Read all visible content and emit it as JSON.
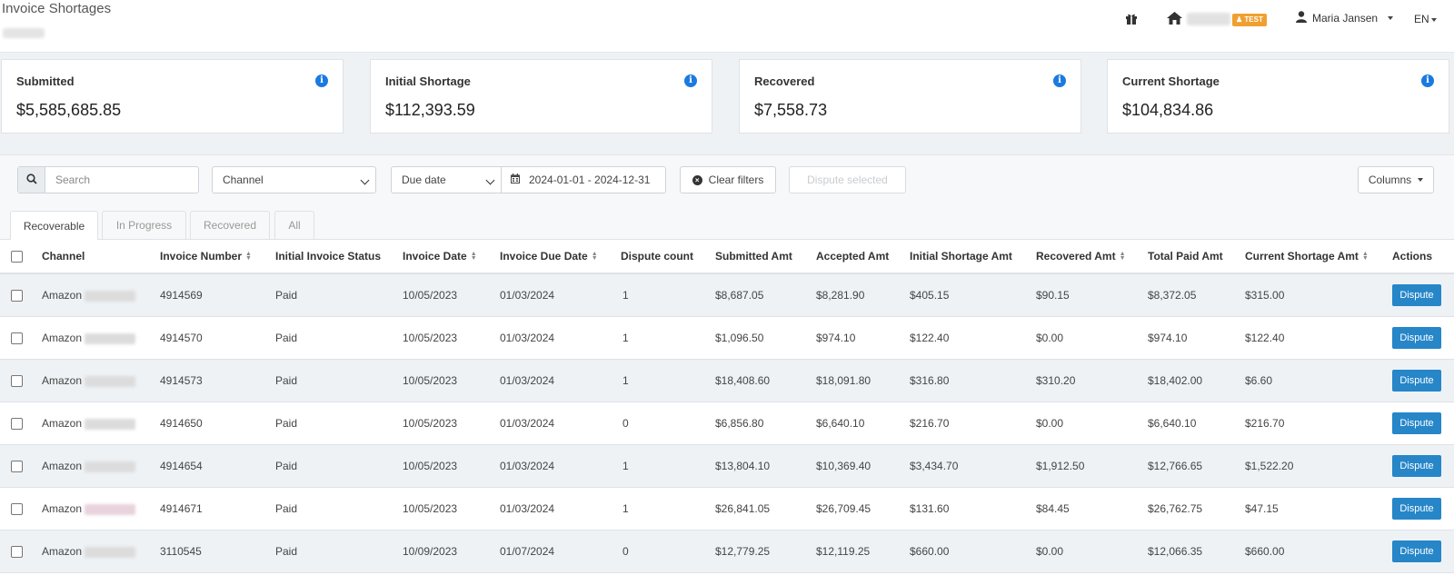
{
  "header": {
    "title": "Invoice Shortages",
    "test_badge": "TEST",
    "user_name": "Maria Jansen",
    "language": "EN"
  },
  "summary_cards": [
    {
      "label": "Submitted",
      "value": "$5,585,685.85"
    },
    {
      "label": "Initial Shortage",
      "value": "$112,393.59"
    },
    {
      "label": "Recovered",
      "value": "$7,558.73"
    },
    {
      "label": "Current Shortage",
      "value": "$104,834.86"
    }
  ],
  "toolbar": {
    "search_placeholder": "Search",
    "channel_select": "Channel",
    "date_field_select": "Due date",
    "date_range": "2024-01-01 - 2024-12-31",
    "clear_filters": "Clear filters",
    "dispute_selected": "Dispute selected",
    "columns": "Columns"
  },
  "tabs": [
    "Recoverable",
    "In Progress",
    "Recovered",
    "All"
  ],
  "table": {
    "headers": [
      "Channel",
      "Invoice Number",
      "Initial Invoice Status",
      "Invoice Date",
      "Invoice Due Date",
      "Dispute count",
      "Submitted Amt",
      "Accepted Amt",
      "Initial Shortage Amt",
      "Recovered Amt",
      "Total Paid Amt",
      "Current Shortage Amt",
      "Actions"
    ],
    "action_label": "Dispute",
    "rows": [
      {
        "channel": "Amazon",
        "invoice": "4914569",
        "status": "Paid",
        "inv_date": "10/05/2023",
        "due_date": "01/03/2024",
        "disputes": "1",
        "submitted": "$8,687.05",
        "accepted": "$8,281.90",
        "initial": "$405.15",
        "recovered": "$90.15",
        "paid": "$8,372.05",
        "current": "$315.00"
      },
      {
        "channel": "Amazon",
        "invoice": "4914570",
        "status": "Paid",
        "inv_date": "10/05/2023",
        "due_date": "01/03/2024",
        "disputes": "1",
        "submitted": "$1,096.50",
        "accepted": "$974.10",
        "initial": "$122.40",
        "recovered": "$0.00",
        "paid": "$974.10",
        "current": "$122.40"
      },
      {
        "channel": "Amazon",
        "invoice": "4914573",
        "status": "Paid",
        "inv_date": "10/05/2023",
        "due_date": "01/03/2024",
        "disputes": "1",
        "submitted": "$18,408.60",
        "accepted": "$18,091.80",
        "initial": "$316.80",
        "recovered": "$310.20",
        "paid": "$18,402.00",
        "current": "$6.60"
      },
      {
        "channel": "Amazon",
        "invoice": "4914650",
        "status": "Paid",
        "inv_date": "10/05/2023",
        "due_date": "01/03/2024",
        "disputes": "0",
        "submitted": "$6,856.80",
        "accepted": "$6,640.10",
        "initial": "$216.70",
        "recovered": "$0.00",
        "paid": "$6,640.10",
        "current": "$216.70"
      },
      {
        "channel": "Amazon",
        "invoice": "4914654",
        "status": "Paid",
        "inv_date": "10/05/2023",
        "due_date": "01/03/2024",
        "disputes": "1",
        "submitted": "$13,804.10",
        "accepted": "$10,369.40",
        "initial": "$3,434.70",
        "recovered": "$1,912.50",
        "paid": "$12,766.65",
        "current": "$1,522.20"
      },
      {
        "channel": "Amazon",
        "invoice": "4914671",
        "status": "Paid",
        "inv_date": "10/05/2023",
        "due_date": "01/03/2024",
        "disputes": "1",
        "submitted": "$26,841.05",
        "accepted": "$26,709.45",
        "initial": "$131.60",
        "recovered": "$84.45",
        "paid": "$26,762.75",
        "current": "$47.15"
      },
      {
        "channel": "Amazon",
        "invoice": "3110545",
        "status": "Paid",
        "inv_date": "10/09/2023",
        "due_date": "01/07/2024",
        "disputes": "0",
        "submitted": "$12,779.25",
        "accepted": "$12,119.25",
        "initial": "$660.00",
        "recovered": "$0.00",
        "paid": "$12,066.35",
        "current": "$660.00"
      }
    ]
  }
}
